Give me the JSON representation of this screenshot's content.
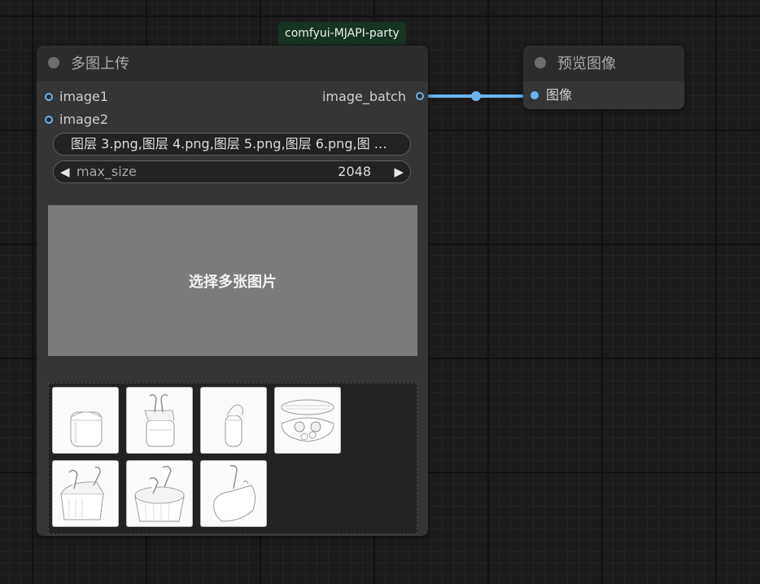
{
  "group": {
    "title": "comfyui-MJAPI-party"
  },
  "upload_node": {
    "title": "多图上传",
    "inputs": [
      {
        "label": "image1"
      },
      {
        "label": "image2"
      }
    ],
    "output": {
      "label": "image_batch"
    },
    "files_combo": {
      "value": "图层 3.png,图层 4.png,图层 5.png,图层 6.png,图 …"
    },
    "max_size": {
      "label": "max_size",
      "value": "2048",
      "left_arrow": "◀",
      "right_arrow": "▶"
    },
    "upload_button": {
      "label": "选择多张图片"
    },
    "gallery": {
      "thumbnails": [
        {
          "icon": "earbuds-case-closed-icon"
        },
        {
          "icon": "earbuds-case-open-icon"
        },
        {
          "icon": "earbud-pod-icon"
        },
        {
          "icon": "earbuds-tray-icon"
        },
        {
          "icon": "earbuds-case-open-angled-icon"
        },
        {
          "icon": "earbuds-case-open-icon"
        },
        {
          "icon": "earbuds-case-small-icon"
        }
      ]
    }
  },
  "preview_node": {
    "title": "预览图像",
    "input": {
      "label": "图像"
    }
  },
  "colors": {
    "link": "#6cb4f0",
    "group_badge": "#173322",
    "node_body": "#353535",
    "node_title": "#2c2c2c",
    "upload_area": "#7b7b7b"
  }
}
